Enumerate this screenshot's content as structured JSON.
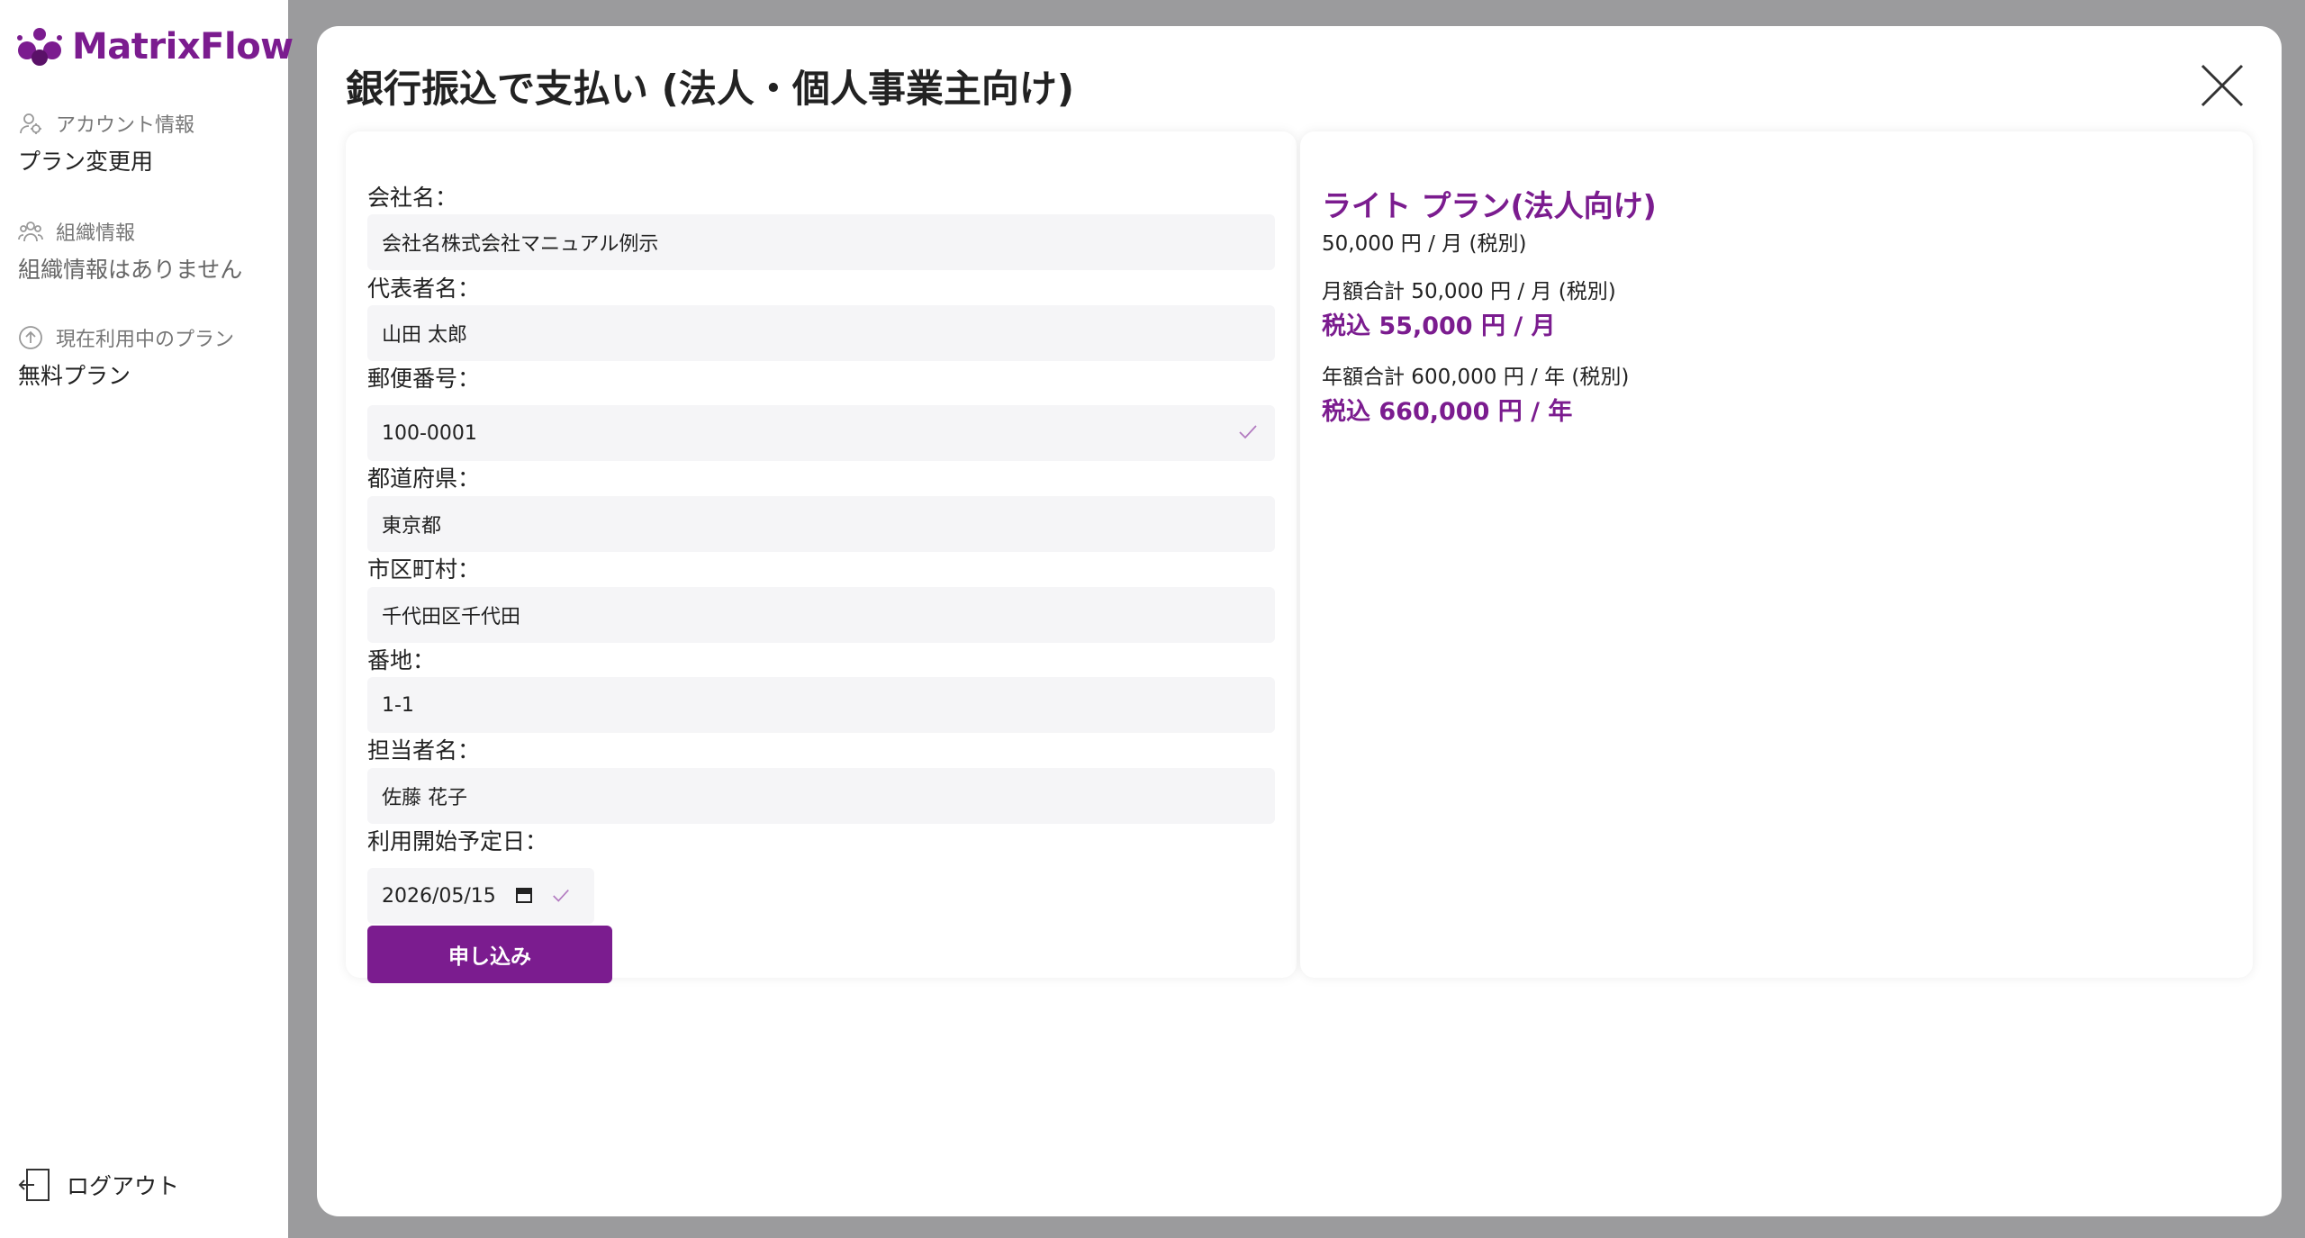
{
  "brand": {
    "name": "MatrixFlow",
    "color": "#7b1c8f"
  },
  "sidebar": {
    "account": {
      "label": "アカウント情報",
      "value": "プラン変更用",
      "icon": "user-icon"
    },
    "organization": {
      "label": "組織情報",
      "value": "組織情報はありません",
      "icon": "group-icon"
    },
    "current_plan": {
      "label": "現在利用中のプラン",
      "value": "無料プラン",
      "icon": "arrow-up-circle-icon"
    },
    "logout_label": "ログアウト"
  },
  "modal": {
    "title": "銀行振込で支払い (法人・個人事業主向け)",
    "form": {
      "company_name": {
        "label": "会社名：",
        "value": "会社名株式会社マニュアル例示"
      },
      "representative": {
        "label": "代表者名：",
        "value": "山田 太郎"
      },
      "postal_code": {
        "label": "郵便番号：",
        "value": "100-0001"
      },
      "prefecture": {
        "label": "都道府県：",
        "value": "東京都"
      },
      "city": {
        "label": "市区町村：",
        "value": "千代田区千代田"
      },
      "address": {
        "label": "番地：",
        "value": "1-1"
      },
      "contact_person": {
        "label": "担当者名：",
        "value": "佐藤 花子"
      },
      "start_date": {
        "label": "利用開始予定日：",
        "value": "2026/05/15"
      },
      "submit_label": "申し込み"
    },
    "plan": {
      "name": "ライト プラン(法人向け)",
      "price": "50,000 円 / 月 (税別)",
      "monthly_total": "月額合計 50,000 円 / 月 (税別)",
      "monthly_with_tax": "税込 55,000 円 / 月",
      "yearly_total": "年額合計 600,000 円 / 年 (税別)",
      "yearly_with_tax": "税込 660,000 円 / 年"
    }
  }
}
